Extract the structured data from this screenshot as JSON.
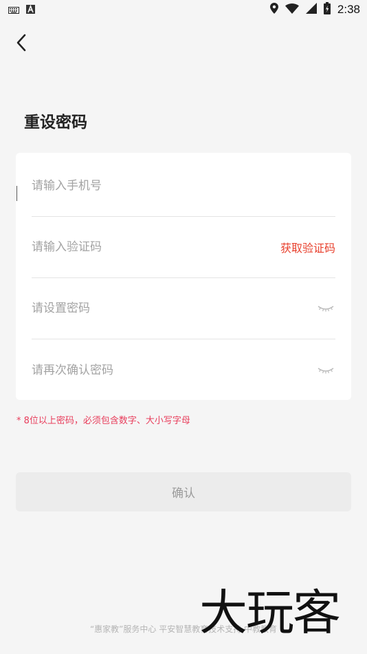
{
  "status_bar": {
    "time": "2:38",
    "icons": [
      "keyboard-icon",
      "a-icon",
      "location-icon",
      "wifi-icon",
      "signal-icon",
      "battery-icon"
    ]
  },
  "header": {
    "back_icon": "back-chevron-icon",
    "title": "重设密码"
  },
  "form": {
    "phone_placeholder": "请输入手机号",
    "code_placeholder": "请输入验证码",
    "get_code_label": "获取验证码",
    "password_placeholder": "请设置密码",
    "confirm_password_placeholder": "请再次确认密码",
    "eye_icon": "eye-closed-icon"
  },
  "hint": "* 8位以上密码，必须包含数字、大小写字母",
  "confirm_button": "确认",
  "footer": "“惠家教”服务中心 平安智慧教育技术支持 中教教育",
  "watermark": "大玩客",
  "colors": {
    "background": "#f5f5f5",
    "accent_red": "#e8402d",
    "hint_pink": "#e83e5c",
    "button_disabled_bg": "#ececec",
    "button_disabled_text": "#9b9b9b"
  }
}
